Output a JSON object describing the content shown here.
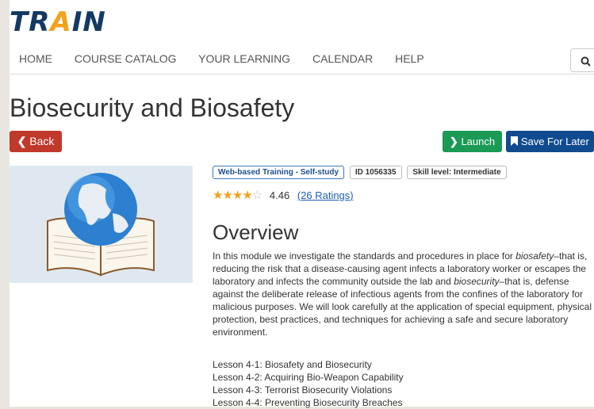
{
  "logo": {
    "text_t": "TR",
    "text_a": "A",
    "text_in": "IN"
  },
  "nav": {
    "items": [
      "HOME",
      "COURSE CATALOG",
      "YOUR LEARNING",
      "CALENDAR",
      "HELP"
    ]
  },
  "search": {
    "icon": "search-icon"
  },
  "course": {
    "title": "Biosecurity and Biosafety",
    "back_label": "Back",
    "launch_label": "Launch",
    "save_label": "Save For Later",
    "badges": {
      "type": "Web-based Training - Self-study",
      "id": "ID 1056335",
      "skill": "Skill level: Intermediate"
    },
    "rating": {
      "stars_filled": 4,
      "stars_total": 5,
      "value": "4.46",
      "count": "(26 Ratings)"
    }
  },
  "overview": {
    "heading": "Overview",
    "p1": "In this module we investigate the standards and procedures in place for ",
    "biosafety": "biosafety",
    "p2": "–that is, reducing the risk that a disease-causing agent infects a laboratory worker or escapes the laboratory and infects the community outside the lab and ",
    "biosecurity": "biosecurity",
    "p3": "–that is, defense against the deliberate release of infectious agents from the confines of the laboratory for malicious purposes. We will look carefully at the application of special equipment, physical protection, best practices, and techniques for achieving a safe and secure laboratory environment.",
    "lessons": [
      "Lesson 4-1: Biosafety and Biosecurity",
      "Lesson 4-2: Acquiring Bio-Weapon Capability",
      "Lesson 4-3: Terrorist Biosecurity Violations",
      "Lesson 4-4: Preventing Biosecurity Breaches"
    ]
  },
  "colors": {
    "brand_navy": "#143a63",
    "brand_orange": "#f2a21c",
    "back_red": "#c0392b",
    "launch_green": "#1a9a55",
    "save_blue": "#114b8f"
  }
}
